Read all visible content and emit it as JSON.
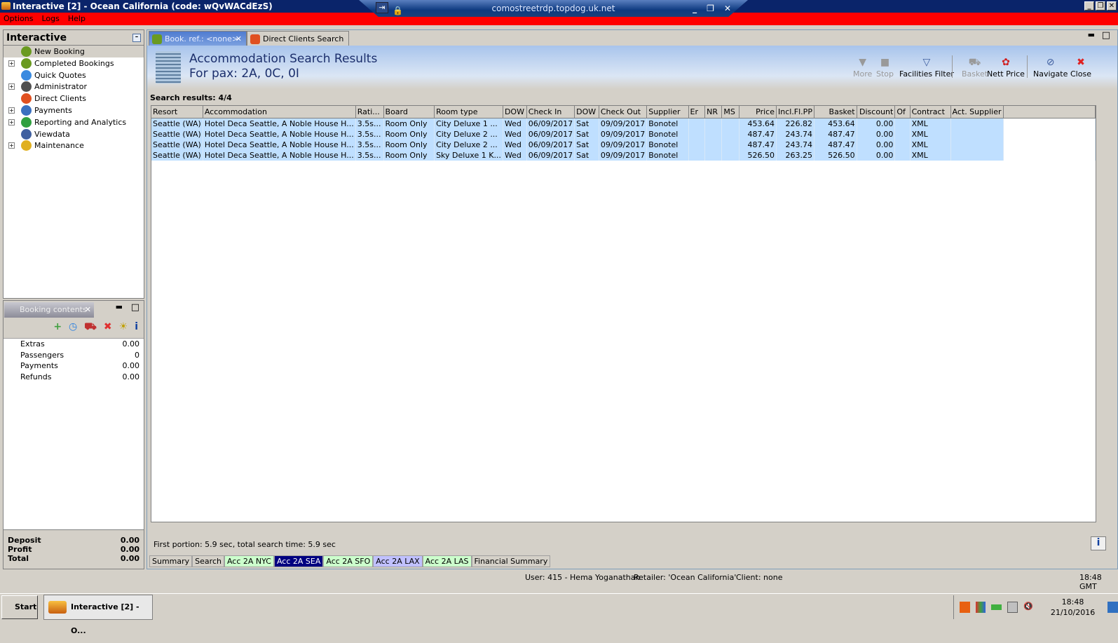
{
  "window": {
    "title": "Interactive [2] - Ocean California (code: wQvWACdEzS)",
    "rdp_host": "comostreetrdp.topdog.uk.net"
  },
  "menu": [
    "Options",
    "Logs",
    "Help"
  ],
  "nav": {
    "title": "Interactive",
    "items": [
      {
        "label": "New Booking",
        "expand": false,
        "color": "#6a9a20"
      },
      {
        "label": "Completed Bookings",
        "expand": true,
        "color": "#6a9a20"
      },
      {
        "label": "Quick Quotes",
        "expand": false,
        "color": "#3a8ae0"
      },
      {
        "label": "Administrator",
        "expand": true,
        "color": "#505050"
      },
      {
        "label": "Direct Clients",
        "expand": false,
        "color": "#e05020"
      },
      {
        "label": "Payments",
        "expand": true,
        "color": "#3a70c0"
      },
      {
        "label": "Reporting and Analytics",
        "expand": true,
        "color": "#30a040"
      },
      {
        "label": "Viewdata",
        "expand": false,
        "color": "#4060a0"
      },
      {
        "label": "Maintenance",
        "expand": true,
        "color": "#e0b020"
      }
    ]
  },
  "booking": {
    "title": "Booking contents",
    "rows": [
      [
        "Extras",
        "0.00"
      ],
      [
        "Passengers",
        "0"
      ],
      [
        "Payments",
        "0.00"
      ],
      [
        "Refunds",
        "0.00"
      ]
    ],
    "footer": [
      [
        "Deposit",
        "0.00"
      ],
      [
        "Profit",
        "0.00"
      ],
      [
        "Total",
        "0.00"
      ]
    ]
  },
  "tabs": [
    {
      "label": "Book. ref.: <none>"
    },
    {
      "label": "Direct Clients Search"
    }
  ],
  "header": {
    "title": "Accommodation Search Results",
    "subtitle": "For pax: 2A, 0C, 0I"
  },
  "toolbar": [
    {
      "label": "More",
      "icon": "▼",
      "disabled": true
    },
    {
      "label": "Stop",
      "icon": "■",
      "disabled": true
    },
    {
      "label": "Facilities Filter",
      "icon": "▽",
      "disabled": false
    },
    {
      "label": "Basket",
      "icon": "⛟",
      "disabled": true
    },
    {
      "label": "Nett Price",
      "icon": "✿",
      "disabled": false
    },
    {
      "label": "Navigate",
      "icon": "⊘",
      "disabled": false
    },
    {
      "label": "Close",
      "icon": "✖",
      "disabled": false
    }
  ],
  "results": {
    "count_label": "Search results: 4/4",
    "columns": [
      "Resort",
      "Accommodation",
      "Rati...",
      "Board",
      "Room type",
      "DOW",
      "Check In",
      "DOW",
      "Check Out",
      "Supplier",
      "Er",
      "NR",
      "MS",
      "Price",
      "Incl.Fl.PP",
      "Basket",
      "Discount",
      "Of",
      "Contract",
      "Act. Supplier"
    ],
    "rows": [
      [
        "Seattle (WA)",
        "Hotel Deca Seattle, A Noble House H...",
        "3.5s...",
        "Room Only",
        "City Deluxe 1 ...",
        "Wed",
        "06/09/2017",
        "Sat",
        "09/09/2017",
        "Bonotel",
        "",
        "",
        "",
        "453.64",
        "226.82",
        "453.64",
        "0.00",
        "",
        "XML",
        ""
      ],
      [
        "Seattle (WA)",
        "Hotel Deca Seattle, A Noble House H...",
        "3.5s...",
        "Room Only",
        "City Deluxe 2 ...",
        "Wed",
        "06/09/2017",
        "Sat",
        "09/09/2017",
        "Bonotel",
        "",
        "",
        "",
        "487.47",
        "243.74",
        "487.47",
        "0.00",
        "",
        "XML",
        ""
      ],
      [
        "Seattle (WA)",
        "Hotel Deca Seattle, A Noble House H...",
        "3.5s...",
        "Room Only",
        "City Deluxe 2 ...",
        "Wed",
        "06/09/2017",
        "Sat",
        "09/09/2017",
        "Bonotel",
        "",
        "",
        "",
        "487.47",
        "243.74",
        "487.47",
        "0.00",
        "",
        "XML",
        ""
      ],
      [
        "Seattle (WA)",
        "Hotel Deca Seattle, A Noble House H...",
        "3.5s...",
        "Room Only",
        "Sky Deluxe 1 K...",
        "Wed",
        "06/09/2017",
        "Sat",
        "09/09/2017",
        "Bonotel",
        "",
        "",
        "",
        "526.50",
        "263.25",
        "526.50",
        "0.00",
        "",
        "XML",
        ""
      ]
    ]
  },
  "search_time": "First portion: 5.9 sec, total search time: 5.9 sec",
  "bottom_tabs": [
    {
      "label": "Summary",
      "bg": "#d4d0c8",
      "fg": "#000"
    },
    {
      "label": "Search",
      "bg": "#d4d0c8",
      "fg": "#000"
    },
    {
      "label": "Acc 2A NYC",
      "bg": "#ccffcc",
      "fg": "#000"
    },
    {
      "label": "Acc 2A SEA",
      "bg": "#000080",
      "fg": "#fff"
    },
    {
      "label": "Acc 2A SFO",
      "bg": "#ccffcc",
      "fg": "#000"
    },
    {
      "label": "Acc 2A LAX",
      "bg": "#c0c0ff",
      "fg": "#000"
    },
    {
      "label": "Acc 2A LAS",
      "bg": "#ccffcc",
      "fg": "#000"
    },
    {
      "label": "Financial Summary",
      "bg": "#d4d0c8",
      "fg": "#000"
    }
  ],
  "status": {
    "user": "User: 415 - Hema Yoganathan",
    "retailer": "Retailer: 'Ocean California'",
    "client": "Client: none",
    "time": "18:48 GMT"
  },
  "taskbar": {
    "start": "Start",
    "task": "Interactive [2] - O...",
    "clock_time": "18:48",
    "clock_date": "21/10/2016"
  }
}
